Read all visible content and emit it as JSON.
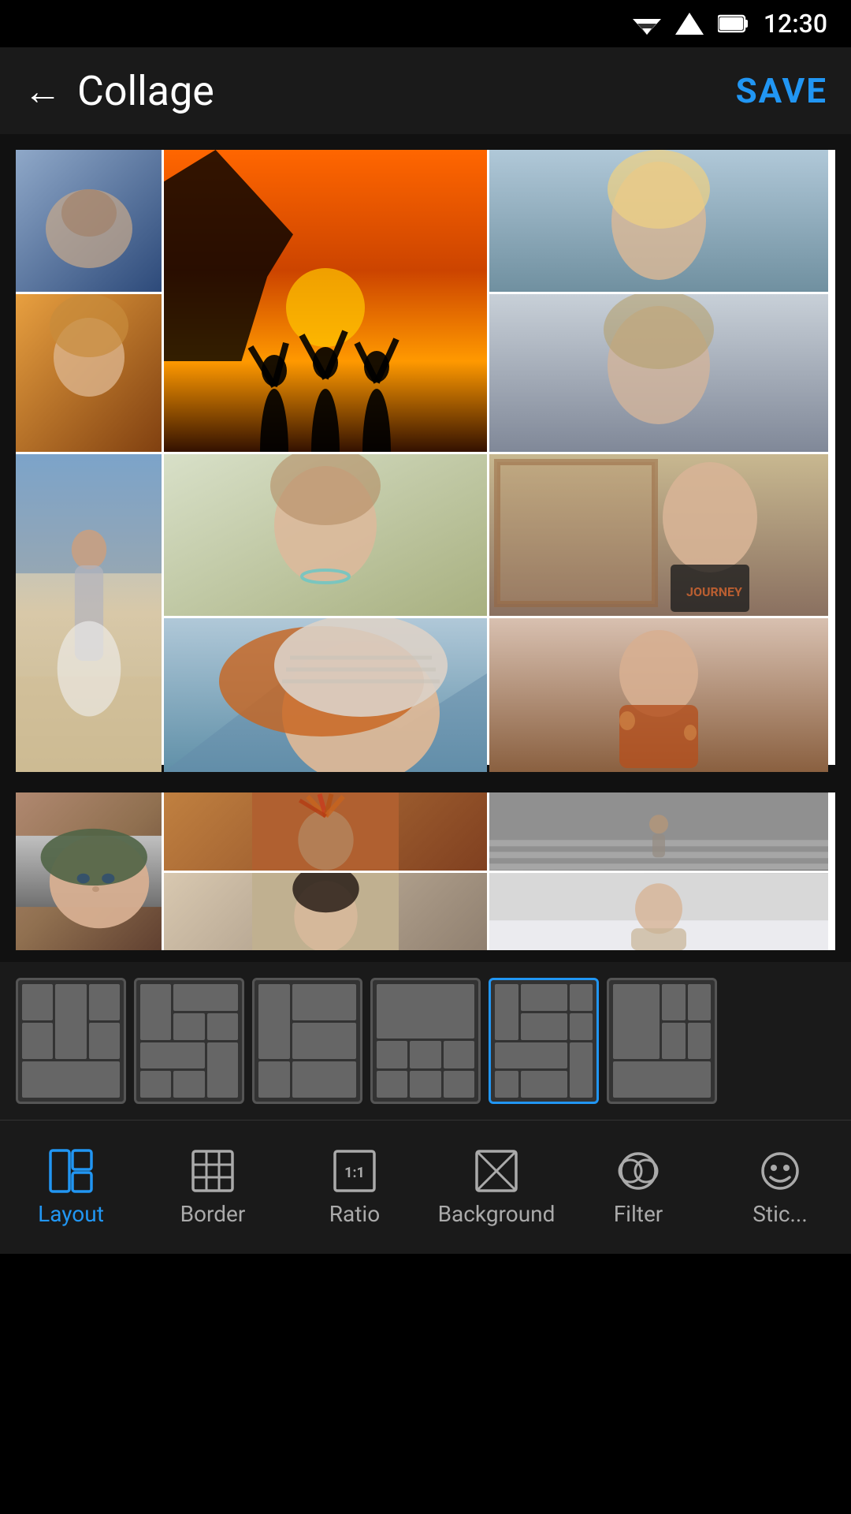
{
  "statusBar": {
    "time": "12:30"
  },
  "header": {
    "title": "Collage",
    "backLabel": "←",
    "saveLabel": "SAVE"
  },
  "collage": {
    "photos": [
      {
        "id": 1,
        "desc": "woman lying down winter hat"
      },
      {
        "id": 2,
        "desc": "silhouettes sunset orange"
      },
      {
        "id": 3,
        "desc": "blonde woman portrait"
      },
      {
        "id": 4,
        "desc": "woman autumn leaves"
      },
      {
        "id": 5,
        "desc": "woman grey background"
      },
      {
        "id": 6,
        "desc": "woman beach bikini"
      },
      {
        "id": 7,
        "desc": "woman smiling necklace"
      },
      {
        "id": 8,
        "desc": "woman journey tshirt"
      },
      {
        "id": 9,
        "desc": "woman red hair beanie close"
      },
      {
        "id": 10,
        "desc": "woman rust dress"
      },
      {
        "id": 11,
        "desc": "native headdress woman"
      },
      {
        "id": 12,
        "desc": "woman beanie close up"
      },
      {
        "id": 13,
        "desc": "woman staircase"
      },
      {
        "id": 14,
        "desc": "asian woman portrait"
      },
      {
        "id": 15,
        "desc": "woman snow coat"
      }
    ]
  },
  "layouts": [
    {
      "id": 1,
      "active": false
    },
    {
      "id": 2,
      "active": false
    },
    {
      "id": 3,
      "active": false
    },
    {
      "id": 4,
      "active": false
    },
    {
      "id": 5,
      "active": true
    },
    {
      "id": 6,
      "active": false
    }
  ],
  "bottomNav": {
    "items": [
      {
        "id": "layout",
        "label": "Layout",
        "active": true
      },
      {
        "id": "border",
        "label": "Border",
        "active": false
      },
      {
        "id": "ratio",
        "label": "Ratio",
        "active": false
      },
      {
        "id": "background",
        "label": "Background",
        "active": false
      },
      {
        "id": "filter",
        "label": "Filter",
        "active": false
      },
      {
        "id": "sticker",
        "label": "Stic...",
        "active": false
      }
    ]
  }
}
